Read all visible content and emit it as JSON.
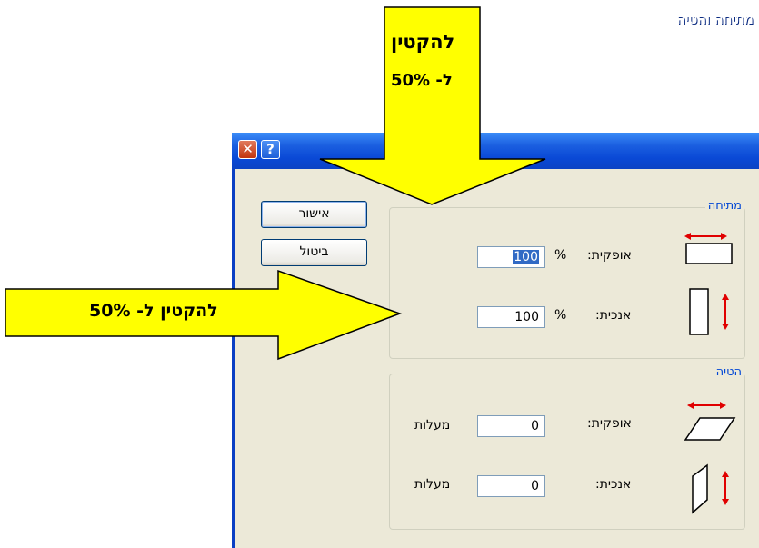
{
  "window": {
    "title": "מתיחה והטיה",
    "close_glyph": "✕",
    "help_glyph": "?"
  },
  "buttons": {
    "ok": "אישור",
    "cancel": "ביטול"
  },
  "stretch": {
    "title": "מתיחה",
    "horizontal_label": "אופקית:",
    "horizontal_value": "100",
    "vertical_label": "אנכית:",
    "vertical_value": "100",
    "percent": "%"
  },
  "skew": {
    "title": "הטיה",
    "horizontal_label": "אופקית:",
    "horizontal_value": "0",
    "vertical_label": "אנכית:",
    "vertical_value": "0",
    "degrees": "מעלות"
  },
  "annotations": {
    "top_arrow_line1": "להקטין",
    "top_arrow_line2": "ל- 50%",
    "left_arrow": "להקטין ל- 50%"
  },
  "colors": {
    "title_bar": "#0a49d6",
    "arrow_fill": "#ffff00",
    "icon_red": "#e00000",
    "group_title": "#0046d5"
  }
}
